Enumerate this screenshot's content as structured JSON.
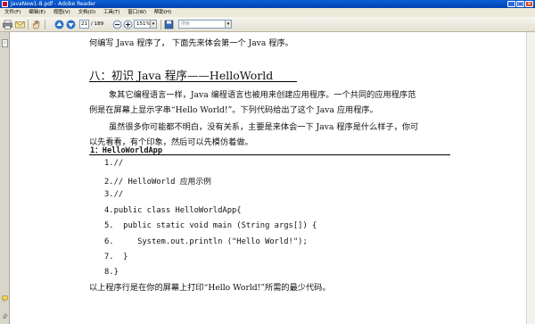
{
  "window": {
    "title": "JavaNew1-8.pdf - Adobe Reader",
    "controls": {
      "minimize": "_",
      "maximize": "□",
      "close": "✕"
    }
  },
  "menu": {
    "items": [
      "文件(F)",
      "编辑(E)",
      "视图(V)",
      "文档(D)",
      "工具(T)",
      "窗口(W)",
      "帮助(H)"
    ]
  },
  "toolbar": {
    "page_current": "21",
    "page_total": "/ 189",
    "zoom": "151%",
    "search_placeholder": "搜索",
    "dropdown_arrow": "▾",
    "icons": [
      "print-icon",
      "email-icon",
      "hand-tool-icon",
      "page-up-icon",
      "page-down-icon",
      "zoom-out-icon",
      "zoom-in-icon",
      "save-icon",
      "fit-page-icon"
    ]
  },
  "nav": {
    "icons": [
      "bookmarks-icon",
      "comments-icon",
      "attachments-icon"
    ]
  },
  "document": {
    "intro_tail": "何编写 Java 程序了， 下面先来体会第一个 Java 程序。",
    "heading": "八：初识 Java 程序——HelloWorld",
    "para1_line1": "象其它编程语言一样，Java 编程语言也被用来创建应用程序。一个共同的应用程序范",
    "para1_line2": "例是在屏幕上显示字串“Hello World!”。下列代码给出了这个 Java 应用程序。",
    "para2_line1": "虽然很多你可能都不明白，没有关系，主要是来体会一下 Java 程序是什么样子，你可",
    "para2_line2": "以先看看，有个印象，然后可以先模仿着做。",
    "subheading": "1：HelloWorldApp",
    "code": [
      "1.//",
      "2.// HelloWorld 应用示例",
      "3.//",
      "4.public class HelloWorldApp{",
      "5.  public static void main (String args[]) {",
      "6.     System.out.println (\"Hello World!\");",
      "7.  }",
      "8.}"
    ],
    "closing": "以上程序行是在你的屏幕上打印“Hello World!”所需的最少代码。"
  }
}
